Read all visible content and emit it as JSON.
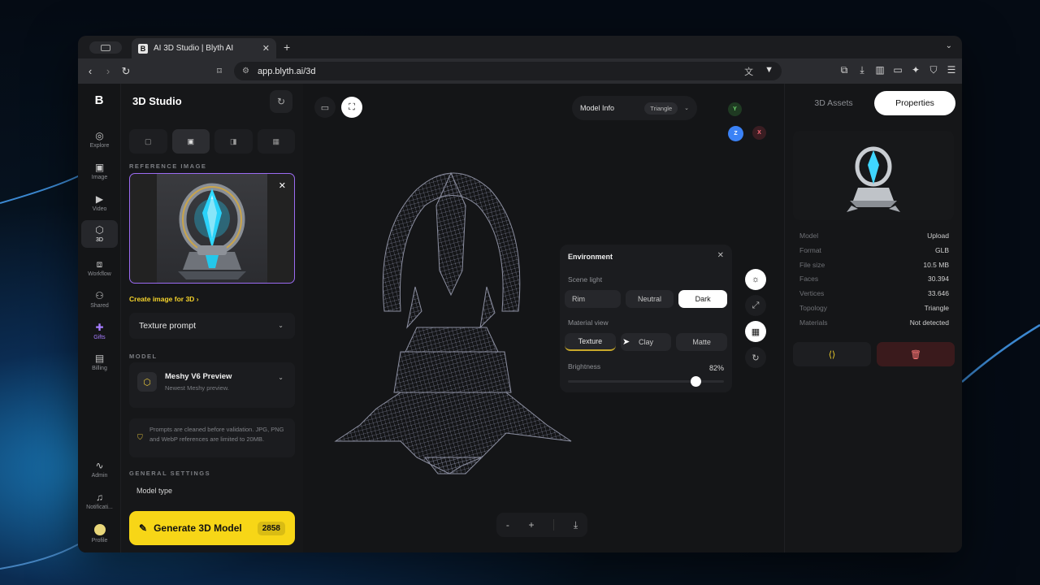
{
  "browser": {
    "tab_title": "AI 3D Studio | Blyth AI",
    "tab_favicon": "B",
    "url": "app.blyth.ai/3d"
  },
  "rail": {
    "logo": "B",
    "items": [
      {
        "label": "Explore",
        "icon": "compass-icon"
      },
      {
        "label": "Image",
        "icon": "image-icon"
      },
      {
        "label": "Video",
        "icon": "video-icon"
      },
      {
        "label": "3D",
        "icon": "cube-icon"
      },
      {
        "label": "Workflow",
        "icon": "workflow-icon"
      },
      {
        "label": "Shared",
        "icon": "users-icon"
      },
      {
        "label": "Gifts",
        "icon": "gift-icon"
      },
      {
        "label": "Billing",
        "icon": "card-icon"
      },
      {
        "label": "Admin",
        "icon": "activity-icon"
      },
      {
        "label": "Notificati...",
        "icon": "bell-icon"
      },
      {
        "label": "Profile",
        "icon": "avatar-icon"
      }
    ]
  },
  "panel": {
    "title": "3D Studio",
    "reference_label": "REFERENCE IMAGE",
    "create_link": "Create image for 3D",
    "texture_prompt": "Texture prompt",
    "model_label": "MODEL",
    "model_name": "Meshy V6 Preview",
    "model_desc": "Newest Meshy preview.",
    "notice": "Prompts are cleaned before validation. JPG, PNG and WebP references are limited to 20MB.",
    "general_label": "GENERAL SETTINGS",
    "model_type": "Model type",
    "generate_label": "Generate 3D Model",
    "generate_cost": "2858"
  },
  "viewport": {
    "model_info_label": "Model Info",
    "topology_pill": "Triangle",
    "axes": {
      "y": "Y",
      "z": "Z",
      "x": "X"
    },
    "environment": {
      "title": "Environment",
      "scene_light_label": "Scene light",
      "scene_light_options": [
        "Rim",
        "Neutral",
        "Dark"
      ],
      "scene_light_selected": "Dark",
      "material_label": "Material view",
      "material_options": [
        "Texture",
        "Clay",
        "Matte"
      ],
      "material_selected": "Texture",
      "brightness_label": "Brightness",
      "brightness_value": "82%",
      "brightness_fraction": 0.82
    },
    "zoom_out": "-",
    "zoom_in": "+"
  },
  "rpanel": {
    "tabs": [
      "3D Assets",
      "Properties"
    ],
    "active_tab": "Properties",
    "properties": [
      {
        "k": "Model",
        "v": "Upload"
      },
      {
        "k": "Format",
        "v": "GLB"
      },
      {
        "k": "File size",
        "v": "10.5 MB"
      },
      {
        "k": "Faces",
        "v": "30.394"
      },
      {
        "k": "Vertices",
        "v": "33.646"
      },
      {
        "k": "Topology",
        "v": "Triangle"
      },
      {
        "k": "Materials",
        "v": "Not detected"
      }
    ]
  },
  "colors": {
    "accent_yellow": "#f7d617",
    "accent_purple": "#9b6bf2",
    "delete_red": "#3a1a1c"
  }
}
